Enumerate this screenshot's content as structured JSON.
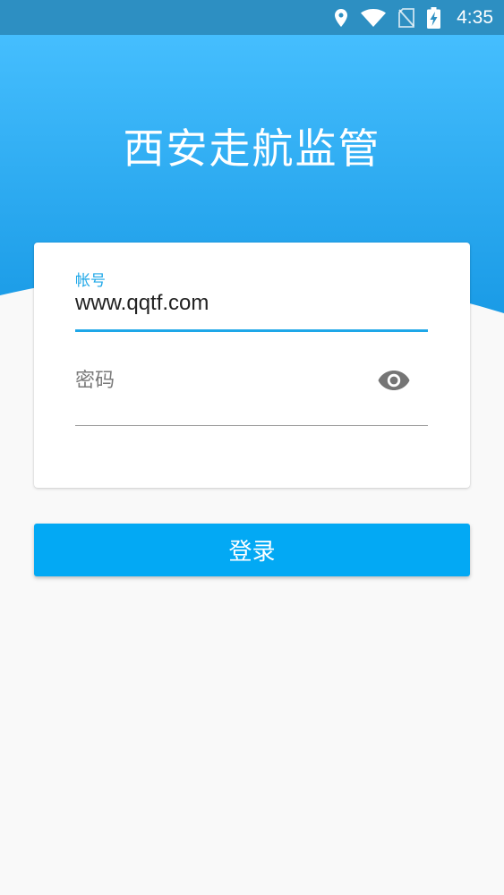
{
  "status_bar": {
    "time": "4:35",
    "icons": [
      "location-icon",
      "wifi-icon",
      "no-sim-icon",
      "battery-charging-icon"
    ]
  },
  "app": {
    "title": "西安走航监管"
  },
  "login_form": {
    "account": {
      "label": "帐号",
      "value": "www.qqtf.com"
    },
    "password": {
      "placeholder": "密码",
      "value": "",
      "toggle_icon": "eye-icon"
    },
    "submit_label": "登录"
  },
  "colors": {
    "status_bar": "#2d8fc2",
    "header_gradient_top": "#45befe",
    "header_gradient_bottom": "#1a9be6",
    "accent": "#1ea7e8",
    "button": "#03a9f4",
    "background": "#f9f9f9"
  }
}
